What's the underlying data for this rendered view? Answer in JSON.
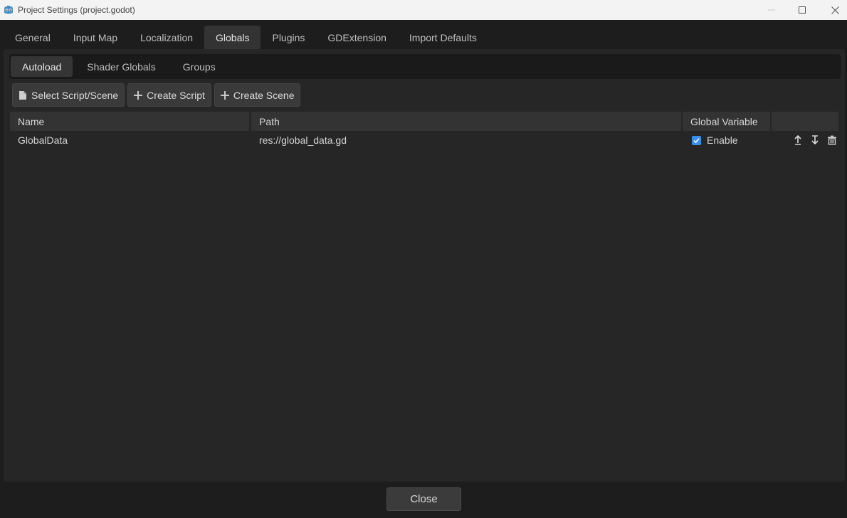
{
  "window": {
    "title": "Project Settings (project.godot)",
    "icon": "godot-icon"
  },
  "tabs": [
    {
      "label": "General"
    },
    {
      "label": "Input Map"
    },
    {
      "label": "Localization"
    },
    {
      "label": "Globals",
      "active": true
    },
    {
      "label": "Plugins"
    },
    {
      "label": "GDExtension"
    },
    {
      "label": "Import Defaults"
    }
  ],
  "subtabs": [
    {
      "label": "Autoload",
      "active": true
    },
    {
      "label": "Shader Globals"
    },
    {
      "label": "Groups"
    }
  ],
  "toolbar": {
    "select_label": "Select Script/Scene",
    "create_script_label": "Create Script",
    "create_scene_label": "Create Scene"
  },
  "table": {
    "columns": [
      "Name",
      "Path",
      "Global Variable",
      ""
    ],
    "rows": [
      {
        "name": "GlobalData",
        "path": "res://global_data.gd",
        "enable_label": "Enable",
        "enabled": true
      }
    ]
  },
  "footer": {
    "close_label": "Close"
  },
  "colors": {
    "accent": "#3b8ee8",
    "background": "#1d1d1d",
    "panel": "#262626"
  }
}
